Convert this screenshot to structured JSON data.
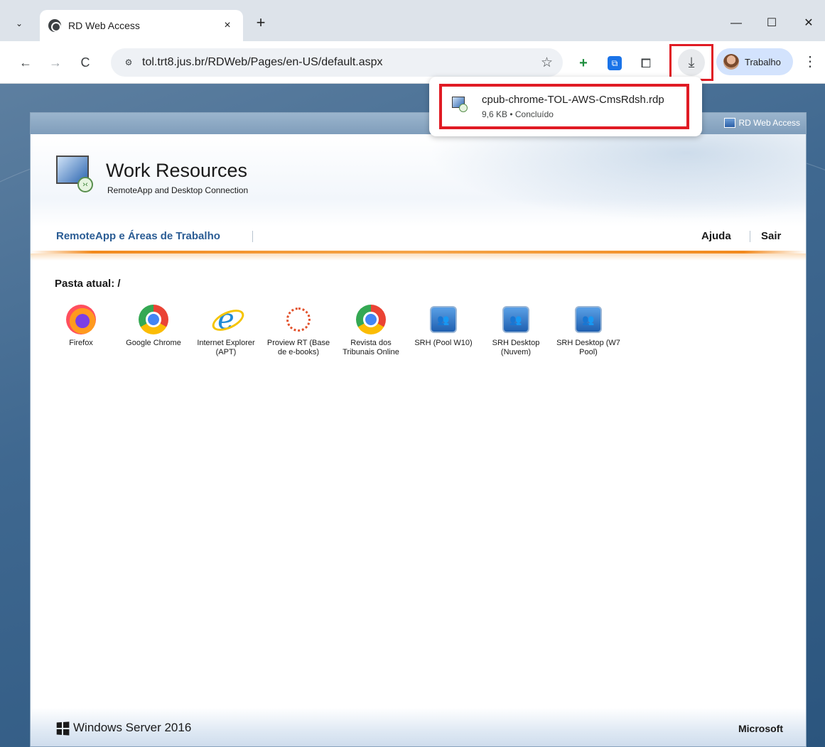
{
  "browser": {
    "tab_title": "RD Web Access",
    "tab_close": "×",
    "new_tab": "+",
    "url": "tol.trt8.jus.br/RDWeb/Pages/en-US/default.aspx",
    "profile_name": "Trabalho",
    "window_controls": {
      "minimize": "—",
      "maximize": "☐",
      "close": "✕"
    },
    "icons": {
      "tab_search": "chevron-down-icon",
      "back": "back-arrow-icon",
      "forward": "forward-arrow-icon",
      "reload": "reload-icon",
      "site_info": "tune-icon",
      "bookmark": "star-icon",
      "extensions": "puzzle-icon",
      "downloads": "download-icon",
      "menu": "kebab-menu-icon"
    },
    "glyphs": {
      "tab_search": "⌄",
      "back": "←",
      "forward": "→",
      "reload": "C",
      "site_info": "⚙",
      "bookmark": "☆",
      "ext_plus": "+",
      "ext_blue": "⧉",
      "extensions": "⧠",
      "downloads": "⤓",
      "menu": "⋮"
    }
  },
  "downloads": {
    "file_name": "cpub-chrome-TOL-AWS-CmsRdsh.rdp",
    "status": "9,6 KB • Concluído"
  },
  "page": {
    "header_label": "RD Web Access",
    "title": "Work Resources",
    "subtitle": "RemoteApp and Desktop Connection",
    "nav": {
      "remoteapp": "RemoteApp e Áreas de Trabalho",
      "help": "Ajuda",
      "logout": "Sair"
    },
    "current_folder": "Pasta atual: /",
    "apps": [
      {
        "label": "Firefox",
        "icon": "firefox-icon"
      },
      {
        "label": "Google Chrome",
        "icon": "chrome-icon"
      },
      {
        "label": "Internet Explorer (APT)",
        "icon": "internet-explorer-icon"
      },
      {
        "label": "Proview RT (Base de e-books)",
        "icon": "proview-icon"
      },
      {
        "label": "Revista dos Tribunais Online",
        "icon": "chrome-icon"
      },
      {
        "label": "SRH (Pool W10)",
        "icon": "remote-desktop-icon"
      },
      {
        "label": "SRH Desktop (Nuvem)",
        "icon": "remote-desktop-icon"
      },
      {
        "label": "SRH Desktop (W7 Pool)",
        "icon": "remote-desktop-icon"
      }
    ],
    "footer_left": "Windows Server 2016",
    "footer_right": "Microsoft"
  },
  "colors": {
    "highlight": "#e01b24",
    "nav_link": "#2a5c94",
    "accent_line": "#f28a1e"
  }
}
